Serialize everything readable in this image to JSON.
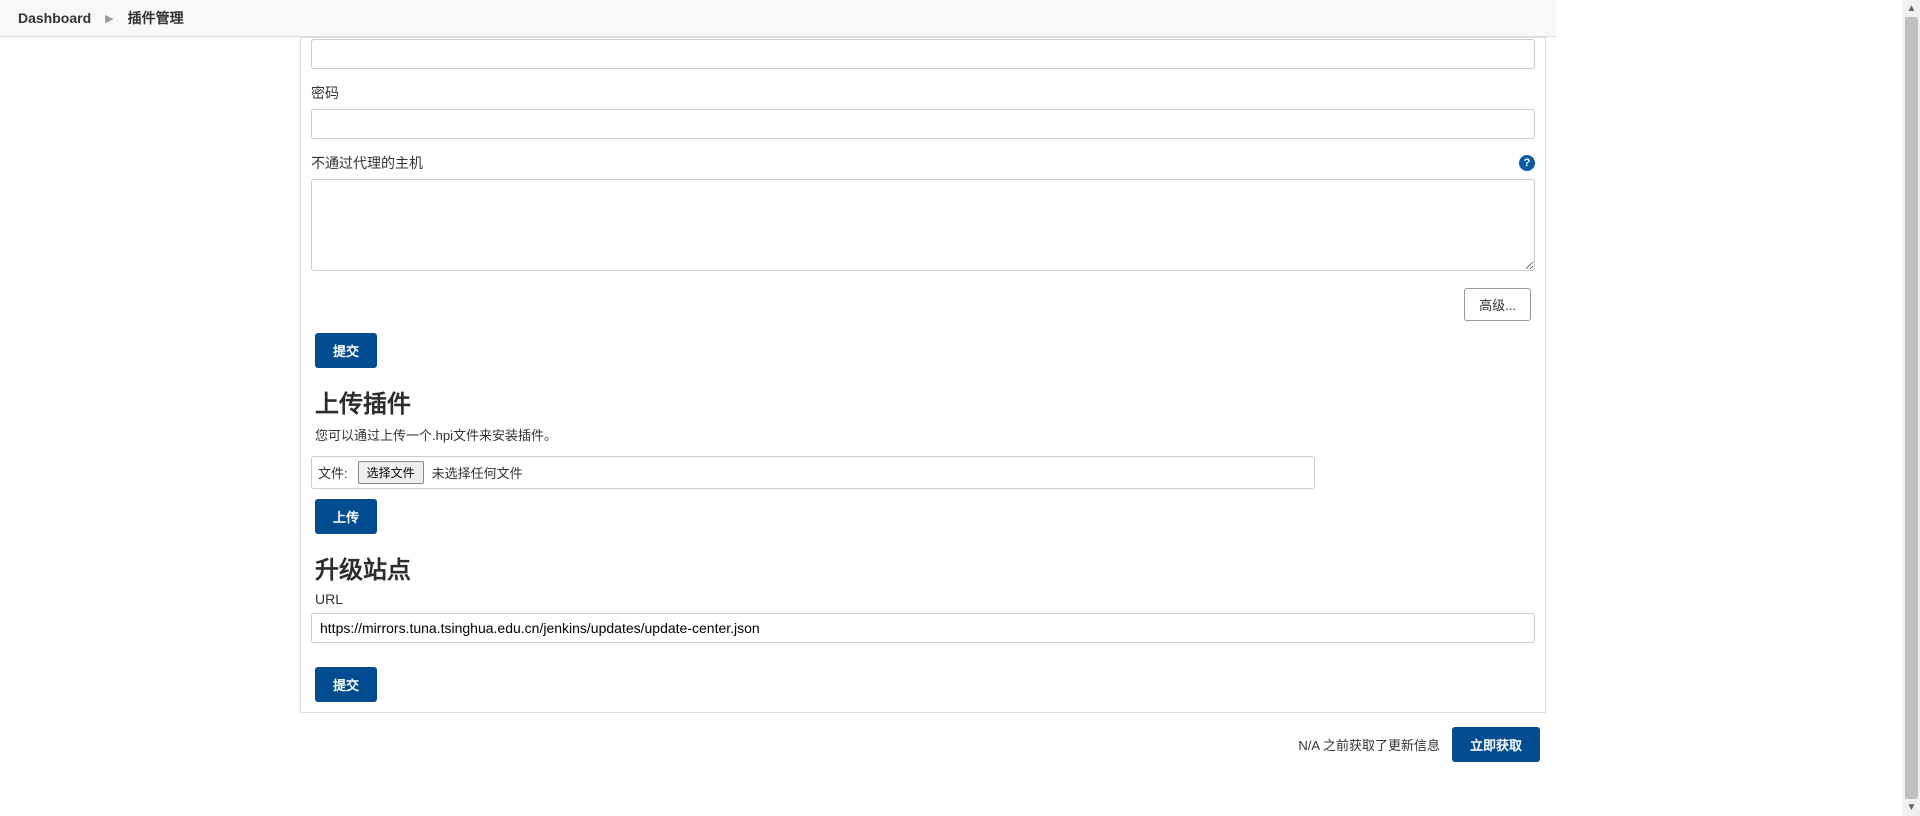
{
  "breadcrumbs": {
    "dashboard": "Dashboard",
    "current": "插件管理"
  },
  "proxy": {
    "password_label": "密码",
    "password_value": "",
    "no_proxy_label": "不通过代理的主机",
    "no_proxy_value": "",
    "advanced_button": "高级...",
    "submit": "提交"
  },
  "upload": {
    "title": "上传插件",
    "desc": "您可以通过上传一个.hpi文件来安装插件。",
    "file_label": "文件:",
    "choose_button": "选择文件",
    "no_file_text": "未选择任何文件",
    "upload_button": "上传"
  },
  "update_site": {
    "title": "升级站点",
    "url_label": "URL",
    "url_value": "https://mirrors.tuna.tsinghua.edu.cn/jenkins/updates/update-center.json",
    "submit": "提交"
  },
  "footer": {
    "info": "N/A 之前获取了更新信息",
    "check_now": "立即获取"
  },
  "icons": {
    "help": "?"
  }
}
